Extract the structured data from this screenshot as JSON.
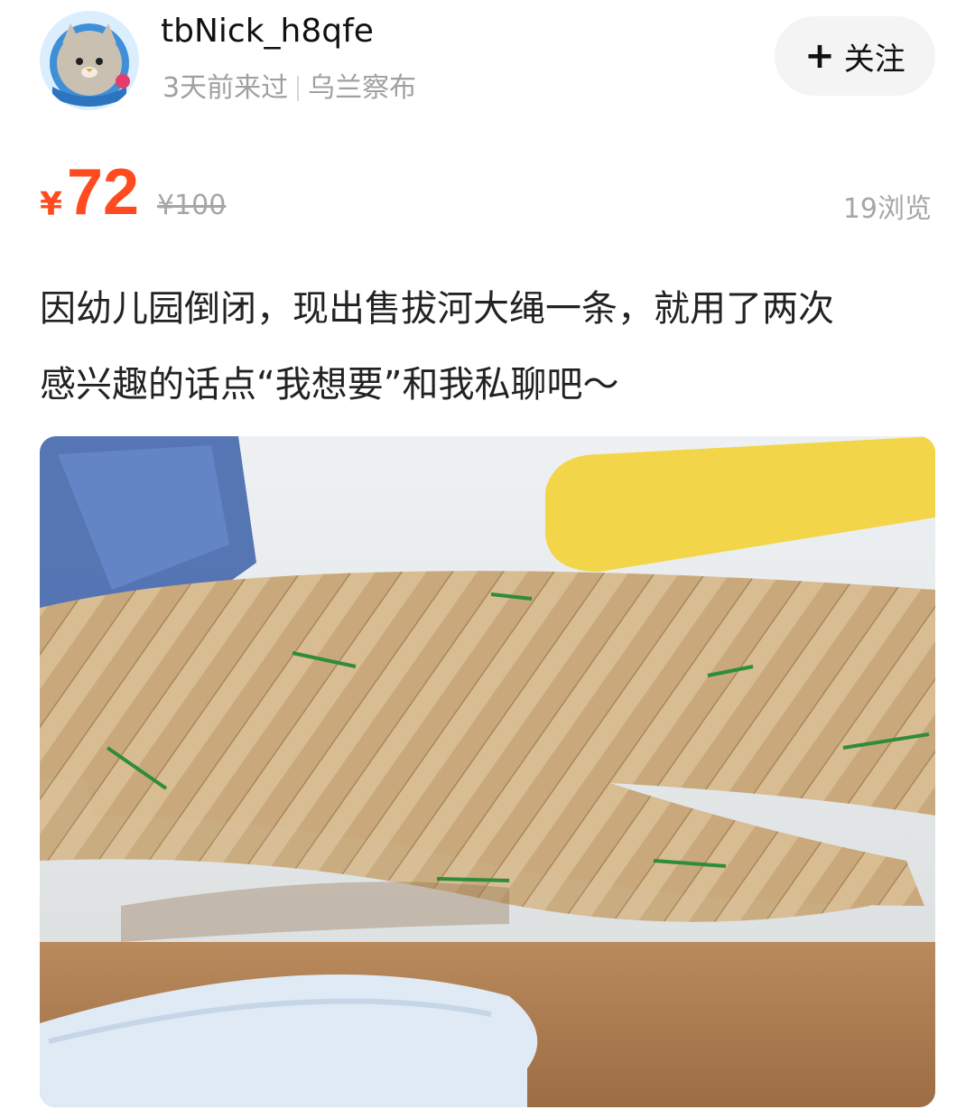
{
  "seller": {
    "avatar_icon": "cat-astronaut-avatar",
    "username": "tbNick_h8qfe",
    "last_seen": "3天前来过",
    "location": "乌兰察布"
  },
  "follow_button": {
    "icon": "plus-icon",
    "label": "关注"
  },
  "price": {
    "currency": "¥",
    "current": "72",
    "original": "¥100",
    "views": "19浏览",
    "accent_color": "#ff4b1f"
  },
  "description": [
    "因幼儿园倒闭，现出售拔河大绳一条，就用了两次",
    "感兴趣的话点“我想要”和我私聊吧～"
  ]
}
